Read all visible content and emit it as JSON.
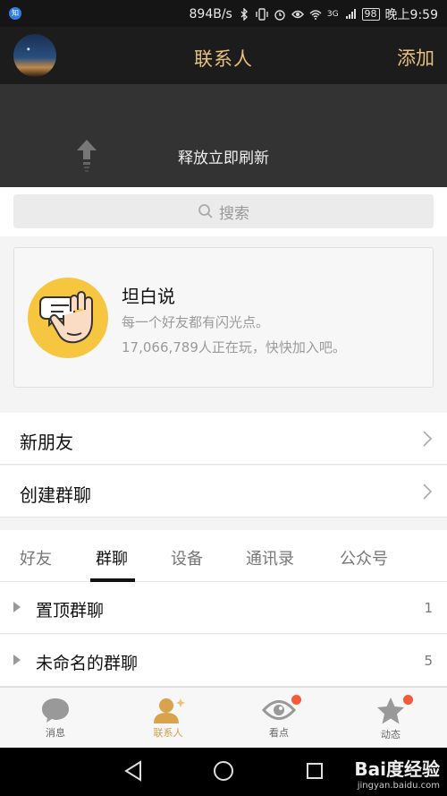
{
  "status_bar": {
    "app_icon_label": "知",
    "network_speed": "894B/s",
    "signal_label": "3G",
    "battery": "98",
    "time": "晚上9:59"
  },
  "header": {
    "title": "联系人",
    "add_label": "添加",
    "title_color": "#e7c07d"
  },
  "pull_refresh": {
    "text": "释放立即刷新"
  },
  "search": {
    "placeholder": "搜索"
  },
  "promo_card": {
    "name": "坦白说",
    "line1": "每一个好友都有闪光点。",
    "line2": "17,066,789人正在玩，快快加入吧。"
  },
  "menu": {
    "items": [
      {
        "label": "新朋友"
      },
      {
        "label": "创建群聊"
      }
    ]
  },
  "tabs": {
    "items": [
      "好友",
      "群聊",
      "设备",
      "通讯录",
      "公众号"
    ],
    "active": "群聊"
  },
  "groups": {
    "items": [
      {
        "label": "置顶群聊",
        "count": "1"
      },
      {
        "label": "未命名的群聊",
        "count": "5"
      }
    ]
  },
  "bottom_nav": {
    "items": [
      {
        "label": "消息",
        "icon": "chat-bubble-icon"
      },
      {
        "label": "联系人",
        "icon": "contacts-person-icon"
      },
      {
        "label": "看点",
        "icon": "eye-icon"
      },
      {
        "label": "动态",
        "icon": "star-icon"
      }
    ],
    "active_color": "#d4a04a"
  },
  "watermark": {
    "brand": "Bai度经验",
    "url": "jingyan.baidu.com"
  }
}
